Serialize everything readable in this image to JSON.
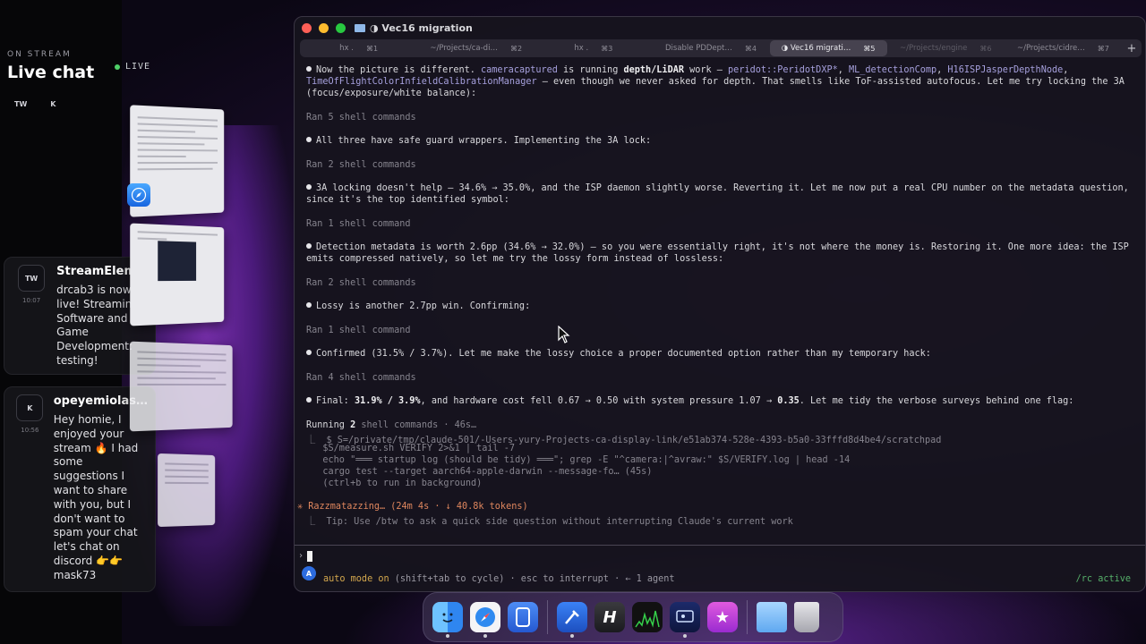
{
  "stream_panel": {
    "on_stream_label": "ON STREAM",
    "title": "Live chat",
    "live_label": "LIVE",
    "participants": [
      "TW",
      "K"
    ],
    "messages": [
      {
        "avatar": "TW",
        "author": "StreamElem…",
        "time": "10:07",
        "text": "drcab3 is now live! Streaming Software and Game Development: testing!"
      },
      {
        "avatar": "K",
        "author": "opeyemiolas…",
        "time": "10:56",
        "text": "Hey homie, I enjoyed your stream 🔥 I had some suggestions I want to share with you, but I don't want to spam your chat let's chat on discord 👉👉 mask73"
      }
    ]
  },
  "window": {
    "title": "◑ Vec16 migration",
    "tabs": [
      {
        "label": "hx .",
        "key": "⌘1",
        "state": "normal"
      },
      {
        "label": "~/Projects/ca-di…",
        "key": "⌘2",
        "state": "normal"
      },
      {
        "label": "hx .",
        "key": "⌘3",
        "state": "normal"
      },
      {
        "label": "Disable PDDept…",
        "key": "⌘4",
        "state": "normal"
      },
      {
        "label": "◑ Vec16 migrati…",
        "key": "⌘5",
        "state": "active"
      },
      {
        "label": "~/Projects/engine",
        "key": "⌘6",
        "state": "dim"
      },
      {
        "label": "~/Projects/cidre…",
        "key": "⌘7",
        "state": "normal"
      }
    ],
    "new_tab_label": "+"
  },
  "terminal": {
    "p1": {
      "a": "Now the picture is different. ",
      "b": "cameracaptured",
      "c": " is running ",
      "d": "depth/LiDAR",
      "e": " work — ",
      "f": "peridot::PeridotDXP*",
      "g": ", ",
      "h": "ML_detectionComp",
      "i": ", ",
      "j": "H16ISPJasperDepthNode",
      "k": ",",
      "l": "TimeOfFlightColorInfieldCalibrationManager",
      "m": " — even though we never asked for depth. That smells like ToF-assisted autofocus. Let me try locking the 3A",
      "n": "(focus/exposure/white balance):"
    },
    "ran1": "Ran 5 shell commands",
    "p2": "All three have safe guard wrappers. Implementing the 3A lock:",
    "ran2": "Ran 2 shell commands",
    "p3a": "3A locking doesn't help — 34.6% → 35.0%, and the ISP daemon slightly worse. Reverting it. Let me now put a real CPU number on the metadata question,",
    "p3b": "since it's the top identified symbol:",
    "ran3": "Ran 1 shell command",
    "p4a": "Detection metadata is worth 2.6pp (34.6% → 32.0%) — so you were essentially right, it's not where the money is. Restoring it. One more idea: the ISP",
    "p4b": "emits compressed natively, so let me try the lossy form instead of lossless:",
    "ran4": "Ran 2 shell commands",
    "p5": "Lossy is another 2.7pp win. Confirming:",
    "ran5": "Ran 1 shell command",
    "p6": "Confirmed (31.5% / 3.7%). Let me make the lossy choice a proper documented option rather than my temporary hack:",
    "ran6": "Ran 4 shell commands",
    "p7": {
      "a": "Final: ",
      "b": "31.9% / 3.9%",
      "c": ", and hardware cost fell 0.67 → 0.50 with system pressure 1.07 → ",
      "d": "0.35",
      "e": ". Let me tidy the verbose surveys behind one flag:"
    },
    "running": {
      "a": "Running ",
      "b": "2",
      "c": " shell commands · 46s…"
    },
    "cmd1": "⎿  $ S=/private/tmp/claude-501/-Users-yury-Projects-ca-display-link/e51ab374-528e-4393-b5a0-33fffd8d4be4/scratchpad",
    "cmd2": "   $S/measure.sh VERIFY 2>&1 | tail -7",
    "cmd3": "   echo \"═══ startup log (should be tidy) ═══\"; grep -E \"^camera:|^avraw:\" $S/VERIFY.log | head -14",
    "cmd4": "   cargo test --target aarch64-apple-darwin --message-fo… (45s)",
    "cmd5": "   (ctrl+b to run in background)",
    "status": "✳ Razzmatazzing… (24m 4s · ↓ 40.8k tokens)",
    "tip": "⎿  Tip: Use /btw to ask a quick side question without interrupting Claude's current work",
    "prompt_symbol": "›",
    "mode": {
      "a": "auto mode on",
      "b": " (shift+tab to cycle) · esc to interrupt · ← 1 agent"
    },
    "agent_badge": "A",
    "rc": "/rc active"
  },
  "dock": {
    "items": [
      "finder-icon",
      "safari-icon",
      "mirror-icon",
      "xcode-beta-icon",
      "h-app-icon",
      "activity-monitor-icon",
      "screen-app-icon",
      "star-app-icon",
      "downloads-folder-icon",
      "trash-icon"
    ],
    "h_label": "H",
    "star_label": "★"
  },
  "colors": {
    "accent_lavender": "#a6a0dd",
    "status_orange": "#e0875e",
    "auto_mode_gold": "#d4a84e",
    "rc_green": "#56b06a",
    "live_green": "#4fd068"
  }
}
